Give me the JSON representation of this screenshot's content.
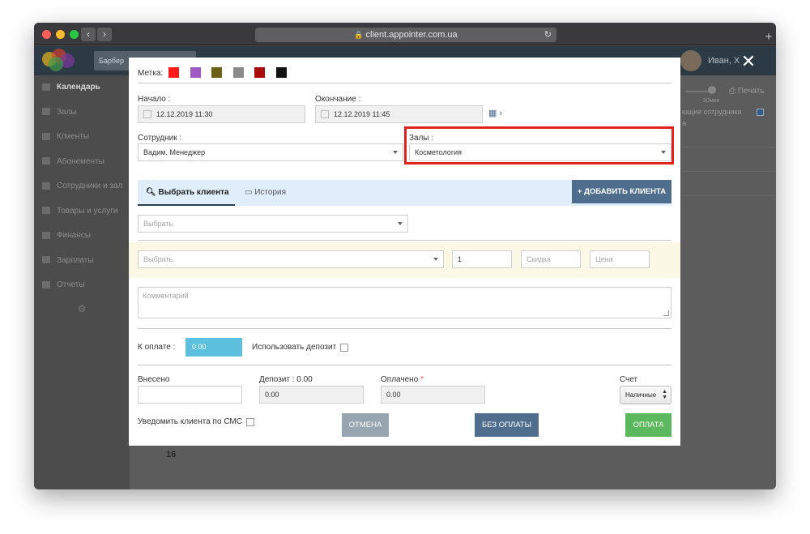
{
  "browser": {
    "url": "client.appointer.com.ua",
    "back_icon": "chevron-left",
    "forward_icon": "chevron-right",
    "reload_icon": "reload",
    "new_tab_icon": "plus"
  },
  "background_app": {
    "salon_tab": "Барбер",
    "user_name": "Иван, Х",
    "sidebar": [
      {
        "label": "Календарь",
        "active": true
      },
      {
        "label": "Залы",
        "active": false
      },
      {
        "label": "Клиенты",
        "active": false
      },
      {
        "label": "Абонементы",
        "active": false
      },
      {
        "label": "Сотрудники и зал",
        "active": false
      },
      {
        "label": "Товары и услуги",
        "active": false
      },
      {
        "label": "Финансы",
        "active": false
      },
      {
        "label": "Зарплаты",
        "active": false
      },
      {
        "label": "Отчеты",
        "active": false
      }
    ],
    "print_label": "Печать",
    "slider_label": "20мин",
    "staff_label": "ющие сотрудники",
    "staff_suffix": "а",
    "day_number": "16"
  },
  "modal": {
    "label_tag": "Метка:",
    "swatches": [
      "#ff1a1a",
      "#9e59c4",
      "#6b6015",
      "#8a8a8a",
      "#a80c0c",
      "#111111"
    ],
    "start_label": "Начало :",
    "start_value": "12.12.2019 11:30",
    "end_label": "Окончание :",
    "end_value": "12.12.2019 11:45",
    "employee_label": "Сотрудник :",
    "employee_value": "Вадим, Менеджер",
    "halls_label": "Залы :",
    "halls_value": "Косметология",
    "tab_select_client": "Выбрать клиента",
    "tab_history": "История",
    "add_client_button": "ДОБАВИТЬ КЛИЕНТА",
    "client_select_placeholder": "Выбрать",
    "service_select_placeholder": "Выбрать",
    "quantity_value": "1",
    "discount_placeholder": "Скидка",
    "price_placeholder": "Цена",
    "comment_placeholder": "Комментарий",
    "to_pay_label": "К оплате :",
    "to_pay_value": "0.00",
    "use_deposit_label": "Использовать депозит",
    "paid_in_label": "Внесено",
    "deposit_label": "Депозит : 0.00",
    "deposit_value": "0.00",
    "paid_label": "Оплачено",
    "paid_required_mark": "*",
    "paid_value": "0.00",
    "account_label": "Счет",
    "account_value": "Наличные",
    "notify_sms_label": "Уведомить клиента по СМС",
    "cancel_button": "ОТМЕНА",
    "no_payment_button": "БЕЗ ОПЛАТЫ",
    "pay_button": "ОПЛАТА",
    "highlight_color": "#e0231f",
    "accent_blue": "#4f6e8e",
    "accent_green": "#5cb85c",
    "accent_cyan": "#5bc0de"
  }
}
